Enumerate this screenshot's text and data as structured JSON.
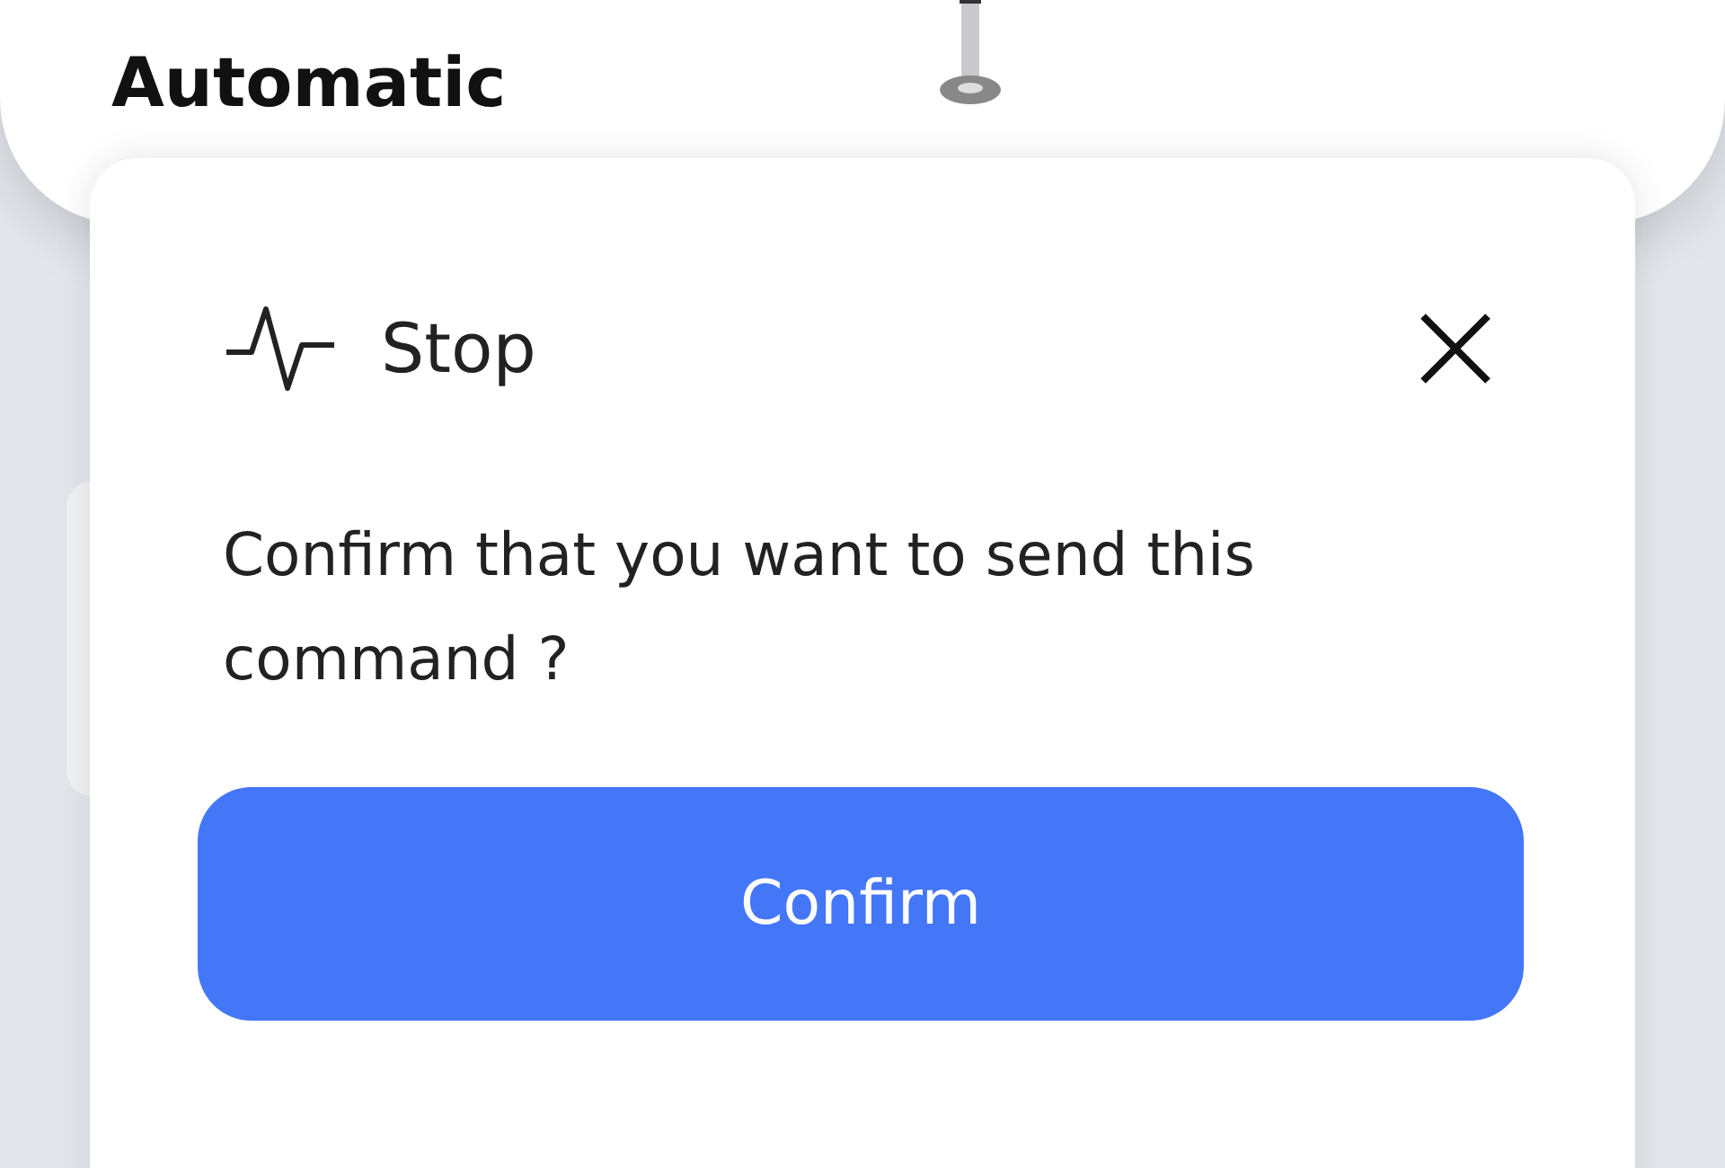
{
  "background_card": {
    "mode": "Automatic"
  },
  "dialog": {
    "title": "Stop",
    "message": "Confirm that you want to send this command ?",
    "confirm_button": "Confirm"
  }
}
